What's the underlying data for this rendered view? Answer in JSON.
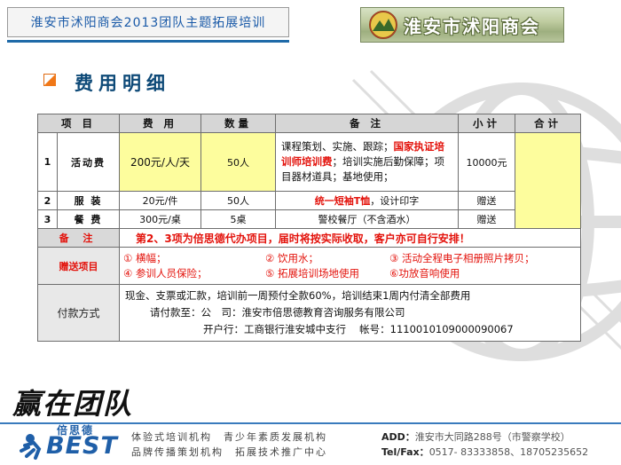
{
  "header": {
    "title": "淮安市沭阳商会2013团队主题拓展培训",
    "logo_text": "淮安市沭阳商会"
  },
  "section_title": "费用明细",
  "table": {
    "headers": [
      "项  目",
      "费  用",
      "数量",
      "备  注",
      "小计",
      "合计"
    ],
    "rows": [
      {
        "num": "1",
        "item": "活动费",
        "fee": "200元/人/天",
        "qty": "50人",
        "note_a": "课程策划、实施、跟踪；",
        "note_red": "国家执证培训师培训费",
        "note_b": "；培训实施后勤保障；项目器材道具；基地使用；",
        "subtotal": "10000元"
      },
      {
        "num": "2",
        "item": "服  装",
        "fee": "20元/件",
        "qty": "50人",
        "note_red": "统一短袖T恤",
        "note_b": "，设计印字",
        "subtotal": "赠送"
      },
      {
        "num": "3",
        "item": "餐  费",
        "fee": "300元/桌",
        "qty": "5桌",
        "note_b": "警校餐厅（不含酒水）",
        "subtotal": "赠送"
      }
    ],
    "remark": {
      "label": "备 注",
      "text": "第2、3项为倍思德代办项目，届时将按实际收取，客户亦可自行安排！"
    },
    "gifts": {
      "label": "赠送项目",
      "items": [
        "① 横幅；",
        "② 饮用水；",
        "③ 活动全程电子相册照片拷贝；",
        "④ 参训人员保险；",
        "⑤ 拓展培训场地使用",
        "⑥功放音响使用"
      ]
    },
    "payment": {
      "label": "付款方式",
      "line1": "现金、支票或汇款，培训前一周预付全款60%，培训结束1周内付清全部费用",
      "line2": "请付款至：公　司：淮安市倍思德教育咨询服务有限公司",
      "line3": "开户行：工商银行淮安城中支行　 帐号：1110010109000090067"
    }
  },
  "footer": {
    "slogan": "赢在团队",
    "brand_cn": "倍思德",
    "brand_en": "BEST",
    "tagline1": "体验式培训机构　青少年素质发展机构",
    "tagline2": "品牌传播策划机构　拓展技术推广中心",
    "addr_label": "ADD：",
    "addr": "淮安市大同路288号（市警察学校）",
    "tel_label": "Tel/Fax：",
    "tel": "0517- 83333858、18705235652"
  }
}
